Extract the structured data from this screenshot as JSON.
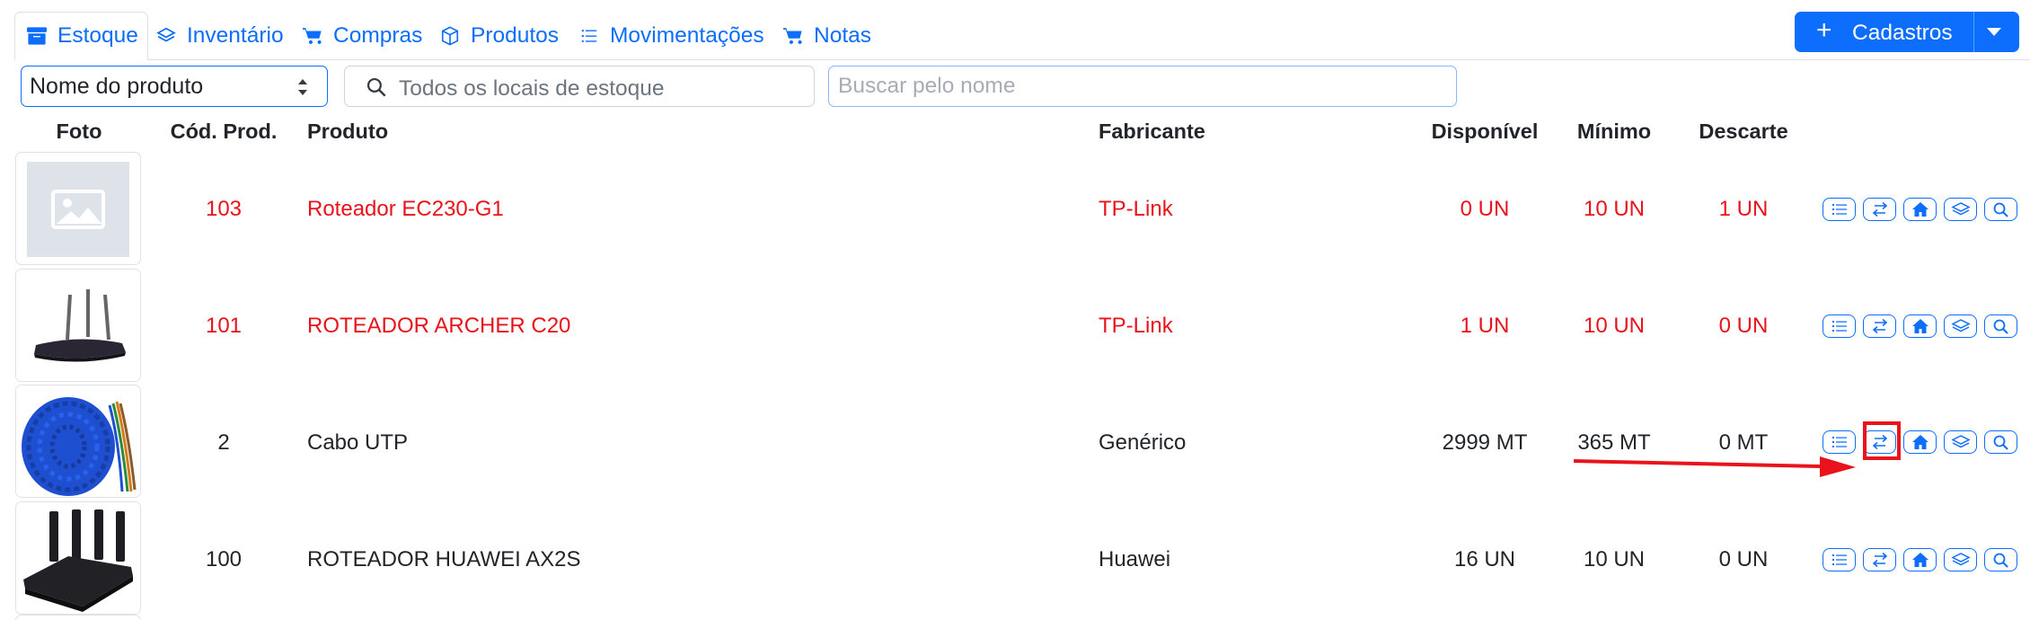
{
  "tabs": [
    {
      "label": "Estoque",
      "icon": "archive-icon",
      "active": true
    },
    {
      "label": "Inventário",
      "icon": "layers-icon"
    },
    {
      "label": "Compras",
      "icon": "cart-icon"
    },
    {
      "label": "Produtos",
      "icon": "box-icon"
    },
    {
      "label": "Movimentações",
      "icon": "list-icon"
    },
    {
      "label": "Notas",
      "icon": "cart-icon"
    }
  ],
  "cadastros_label": "Cadastros",
  "filters": {
    "sort_value": "Nome do produto",
    "location_placeholder": "Todos os locais de estoque",
    "search_placeholder": "Buscar pelo nome"
  },
  "table": {
    "headers": [
      "Foto",
      "Cód. Prod.",
      "Produto",
      "Fabricante",
      "Disponível",
      "Mínimo",
      "Descarte"
    ],
    "rows": [
      {
        "code": "103",
        "product": "Roteador EC230-G1",
        "maker": "TP-Link",
        "available": "0 UN",
        "minimum": "10 UN",
        "discard": "1 UN",
        "alert": true,
        "photo": "placeholder-image-icon"
      },
      {
        "code": "101",
        "product": "ROTEADOR ARCHER C20",
        "maker": "TP-Link",
        "available": "1 UN",
        "minimum": "10 UN",
        "discard": "0 UN",
        "alert": true,
        "photo": "router-photo"
      },
      {
        "code": "2",
        "product": "Cabo UTP",
        "maker": "Genérico",
        "available": "2999 MT",
        "minimum": "365 MT",
        "discard": "0 MT",
        "alert": false,
        "photo": "cable-spool-photo"
      },
      {
        "code": "100",
        "product": "ROTEADOR HUAWEI AX2S",
        "maker": "Huawei",
        "available": "16 UN",
        "minimum": "10 UN",
        "discard": "0 UN",
        "alert": false,
        "photo": "router-photo"
      }
    ]
  },
  "row_actions": [
    "list-icon",
    "transfer-arrows-icon",
    "house-icon",
    "layers-icon",
    "search-icon"
  ],
  "colors": {
    "primary": "#0d6efd",
    "alert": "#e8131b",
    "annotation": "#e8131b"
  }
}
